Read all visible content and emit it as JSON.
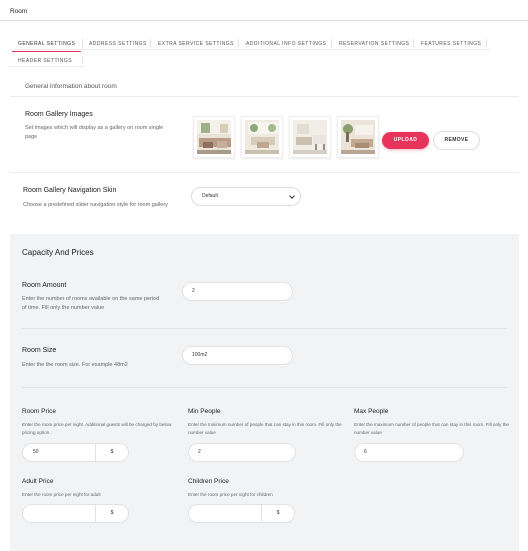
{
  "window": {
    "title": "Room"
  },
  "tabs": [
    {
      "label": "GENERAL SETTINGS"
    },
    {
      "label": "ADDRESS SETTINGS"
    },
    {
      "label": "EXTRA SERVICE SETTINGS"
    },
    {
      "label": "ADDITIONAL INFO SETTINGS"
    },
    {
      "label": "RESERVATION SETTINGS"
    },
    {
      "label": "FEATURES SETTINGS"
    },
    {
      "label": "HEADER SETTINGS"
    }
  ],
  "general": {
    "subtitle": "General information about room",
    "gallery": {
      "label": "Room Gallery Images",
      "desc": "Set images which will display as a gallery on room single page",
      "upload_label": "UPLOAD",
      "remove_label": "REMOVE"
    },
    "nav_skin": {
      "label": "Room Gallery Navigation Skin",
      "desc": "Choose a predefined slider navigation style for room gallery",
      "selected": "Default"
    }
  },
  "capacity": {
    "title": "Capacity And Prices",
    "room_amount": {
      "label": "Room Amount",
      "desc": "Enter the number of rooms available on the same period of time. Fill only the number value",
      "value": "2"
    },
    "room_size": {
      "label": "Room Size",
      "desc": "Enter the the room size. For example 48m2",
      "value": "100m2"
    },
    "room_price": {
      "label": "Room Price",
      "desc": "Enter the room price per night. Additional guests will be charged by below pricing option.",
      "value": "50",
      "currency": "$"
    },
    "min_people": {
      "label": "Min People",
      "desc": "Enter the minimum number of people that can stay in this room. Fill only the number value",
      "value": "2"
    },
    "max_people": {
      "label": "Max People",
      "desc": "Enter the maximum number of people that can stay in this room. Fill only the number value",
      "value": "6"
    },
    "adult_price": {
      "label": "Adult Price",
      "desc": "Enter the room price per night for adult",
      "value": "",
      "currency": "$"
    },
    "children_price": {
      "label": "Children Price",
      "desc": "Enter the room price per night for children",
      "value": "",
      "currency": "$"
    }
  },
  "colors": {
    "accent": "#e8335a",
    "panel_bg": "#f2f3f5"
  }
}
